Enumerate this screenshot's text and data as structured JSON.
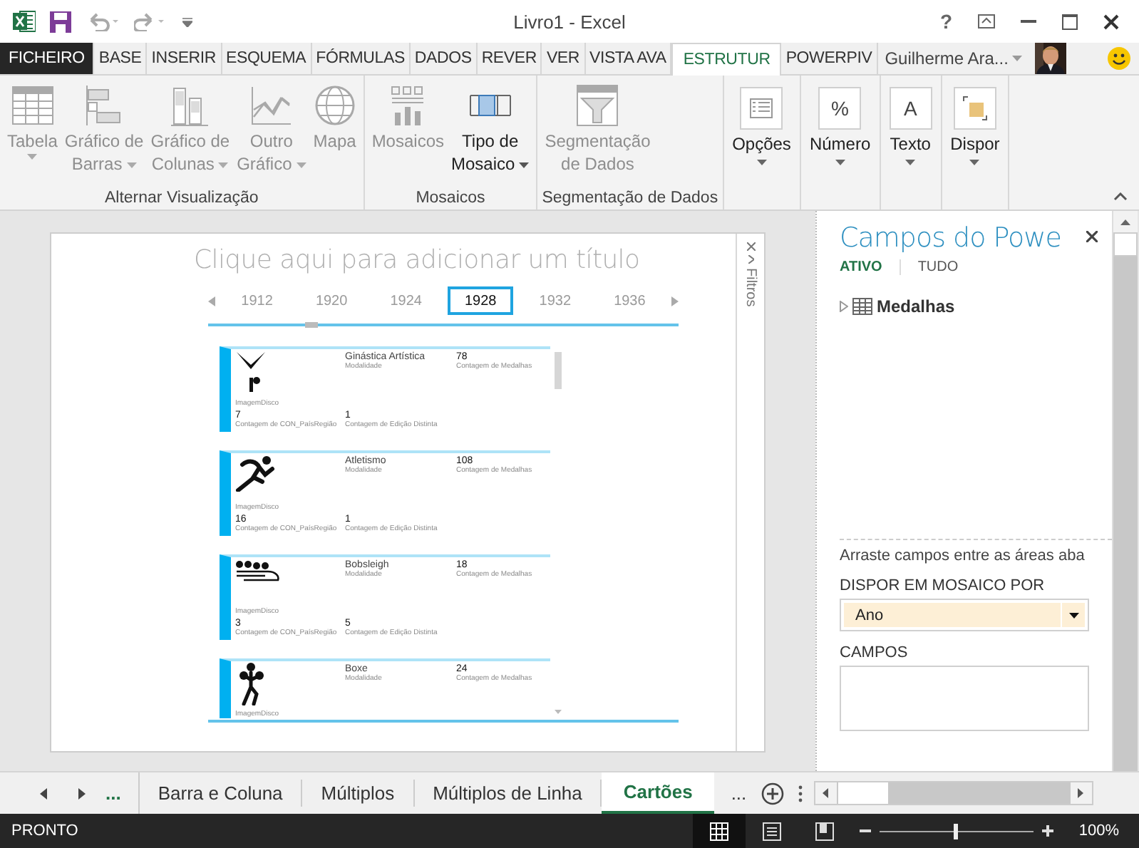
{
  "window": {
    "title": "Livro1 - Excel",
    "help": "?"
  },
  "ribbon_tabs": [
    {
      "label": "FICHEIRO",
      "kind": "file",
      "selected": false
    },
    {
      "label": "BASE",
      "kind": "tab",
      "selected": false
    },
    {
      "label": "INSERIR",
      "kind": "tab",
      "selected": false
    },
    {
      "label": "ESQUEMA",
      "kind": "tab",
      "selected": false
    },
    {
      "label": "FÓRMULAS",
      "kind": "tab",
      "selected": false
    },
    {
      "label": "DADOS",
      "kind": "tab",
      "selected": false
    },
    {
      "label": "REVER",
      "kind": "tab",
      "selected": false
    },
    {
      "label": "VER",
      "kind": "tab",
      "selected": false
    },
    {
      "label": "VISTA AVA",
      "kind": "tab",
      "selected": false
    },
    {
      "label": "ESTRUTUR",
      "kind": "tab",
      "selected": true
    },
    {
      "label": "POWERPIV",
      "kind": "tab",
      "selected": false
    }
  ],
  "account": {
    "name": "Guilherme Ara..."
  },
  "ribbon_groups": [
    {
      "kind": "large",
      "label": "Alternar Visualização",
      "buttons": [
        {
          "lines": [
            "Tabela"
          ],
          "dropdown": true,
          "disabled": true
        },
        {
          "lines": [
            "Gráfico de",
            "Barras"
          ],
          "dropdown": true,
          "disabled": true
        },
        {
          "lines": [
            "Gráfico de",
            "Colunas"
          ],
          "dropdown": true,
          "disabled": true
        },
        {
          "lines": [
            "Outro",
            "Gráfico"
          ],
          "dropdown": true,
          "disabled": true
        },
        {
          "lines": [
            "Mapa"
          ],
          "dropdown": false,
          "disabled": true
        }
      ]
    },
    {
      "kind": "large",
      "label": "Mosaicos",
      "buttons": [
        {
          "lines": [
            "Mosaicos"
          ],
          "dropdown": false,
          "disabled": true
        },
        {
          "lines": [
            "Tipo de",
            "Mosaico"
          ],
          "dropdown": true,
          "disabled": false
        }
      ]
    },
    {
      "kind": "large",
      "label": "Segmentação de Dados",
      "buttons": [
        {
          "lines": [
            "Segmentação",
            "de Dados"
          ],
          "dropdown": false,
          "disabled": true
        }
      ]
    },
    {
      "kind": "compact",
      "buttons": [
        {
          "lines": [
            "Opções"
          ],
          "dropdown": true,
          "disabled": false
        }
      ]
    },
    {
      "kind": "compact",
      "buttons": [
        {
          "lines": [
            "Número"
          ],
          "glyph": "%",
          "dropdown": true,
          "disabled": false
        }
      ]
    },
    {
      "kind": "compact",
      "buttons": [
        {
          "lines": [
            "Texto"
          ],
          "glyph": "A",
          "dropdown": true,
          "disabled": false
        }
      ]
    },
    {
      "kind": "compact",
      "buttons": [
        {
          "lines": [
            "Dispor"
          ],
          "dropdown": true,
          "disabled": false
        }
      ]
    }
  ],
  "report": {
    "title_prompt": "Clique aqui para adicionar um título",
    "filters_label": "Filtros",
    "timeline": {
      "years": [
        {
          "label": "1912",
          "selected": false
        },
        {
          "label": "1920",
          "selected": false
        },
        {
          "label": "1924",
          "selected": false
        },
        {
          "label": "1928",
          "selected": true
        },
        {
          "label": "1932",
          "selected": false
        },
        {
          "label": "1936",
          "selected": false
        }
      ]
    },
    "cards": [
      {
        "image_label": "ImagemDisco",
        "name": "Ginástica Artística",
        "name_label": "Modalidade",
        "medals": "78",
        "medals_label": "Contagem de Medalhas",
        "stats": [
          {
            "value": "7",
            "label": "Contagem de CON_PaísRegião"
          },
          {
            "value": "1",
            "label": "Contagem de Edição Distinta"
          }
        ]
      },
      {
        "image_label": "ImagemDisco",
        "name": "Atletismo",
        "name_label": "Modalidade",
        "medals": "108",
        "medals_label": "Contagem de Medalhas",
        "stats": [
          {
            "value": "16",
            "label": "Contagem de CON_PaísRegião"
          },
          {
            "value": "1",
            "label": "Contagem de Edição Distinta"
          }
        ]
      },
      {
        "image_label": "ImagemDisco",
        "name": "Bobsleigh",
        "name_label": "Modalidade",
        "medals": "18",
        "medals_label": "Contagem de Medalhas",
        "stats": [
          {
            "value": "3",
            "label": "Contagem de CON_PaísRegião"
          },
          {
            "value": "5",
            "label": "Contagem de Edição Distinta"
          }
        ]
      },
      {
        "image_label": "ImagemDisco",
        "name": "Boxe",
        "name_label": "Modalidade",
        "medals": "24",
        "medals_label": "Contagem de Medalhas"
      }
    ]
  },
  "fields_pane": {
    "title": "Campos do Powe",
    "tabs": [
      {
        "label": "ATIVO",
        "selected": true
      },
      {
        "label": "TUDO",
        "selected": false
      }
    ],
    "tables": [
      {
        "name": "Medalhas",
        "expanded": false
      }
    ],
    "hint": "Arraste campos entre as áreas aba",
    "tile_by": {
      "label": "DISPOR EM MOSAICO POR",
      "value": "Ano"
    },
    "fields": {
      "label": "CAMPOS"
    }
  },
  "sheet_tabs": {
    "overflow_left": "...",
    "overflow_right": "...",
    "tabs": [
      {
        "label": "Barra e Coluna",
        "selected": false
      },
      {
        "label": "Múltiplos",
        "selected": false
      },
      {
        "label": "Múltiplos de Linha",
        "selected": false
      },
      {
        "label": "Cartões",
        "selected": true
      }
    ]
  },
  "status_bar": {
    "status": "PRONTO",
    "views": [
      {
        "selected": true
      },
      {
        "selected": false
      },
      {
        "selected": false
      }
    ],
    "zoom": {
      "level": 0.49,
      "reading": "100%"
    }
  }
}
